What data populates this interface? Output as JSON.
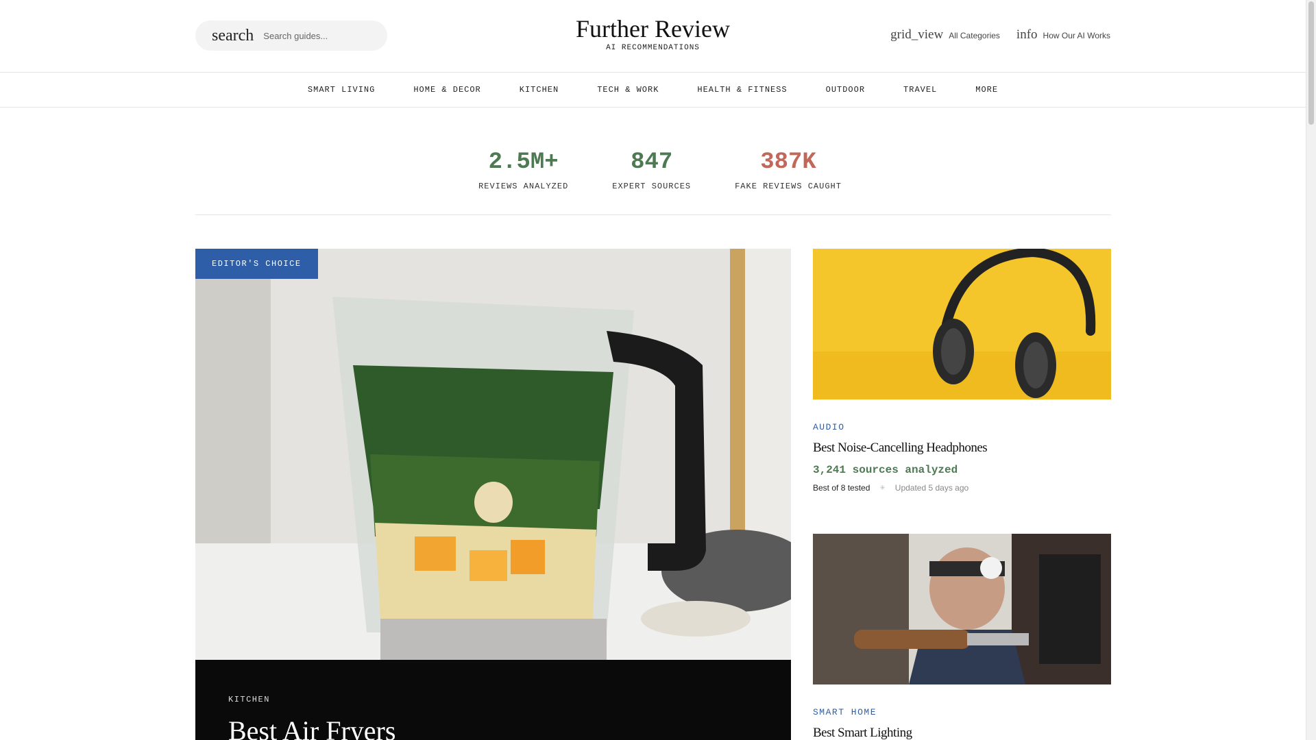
{
  "header": {
    "search": {
      "icon": "search",
      "placeholder": "Search guides..."
    },
    "brand": {
      "name": "Further Review",
      "tagline": "AI RECOMMENDATIONS"
    },
    "links": [
      {
        "icon": "grid_view",
        "label": "All Categories"
      },
      {
        "icon": "info",
        "label": "How Our AI Works"
      }
    ]
  },
  "nav": {
    "items": [
      "SMART LIVING",
      "HOME & DECOR",
      "KITCHEN",
      "TECH & WORK",
      "HEALTH & FITNESS",
      "OUTDOOR",
      "TRAVEL",
      "MORE"
    ]
  },
  "stats": [
    {
      "value": "2.5M+",
      "label": "REVIEWS ANALYZED",
      "color": "#4d7a52"
    },
    {
      "value": "847",
      "label": "EXPERT SOURCES",
      "color": "#4d7a52"
    },
    {
      "value": "387K",
      "label": "FAKE REVIEWS CAUGHT",
      "color": "#c2685a"
    }
  ],
  "feature": {
    "badge": "EDITOR'S CHOICE",
    "category": "KITCHEN",
    "title": "Best Air Fryers"
  },
  "cards": [
    {
      "category": "AUDIO",
      "title": "Best Noise-Cancelling Headphones",
      "sources": "3,241 sources analyzed",
      "best": "Best of 8 tested",
      "updated": "Updated 5 days ago"
    },
    {
      "category": "SMART HOME",
      "title": "Best Smart Lighting"
    }
  ],
  "colors": {
    "accent_blue": "#2d5ea7",
    "accent_green": "#4d7a52",
    "accent_red": "#c2685a"
  }
}
